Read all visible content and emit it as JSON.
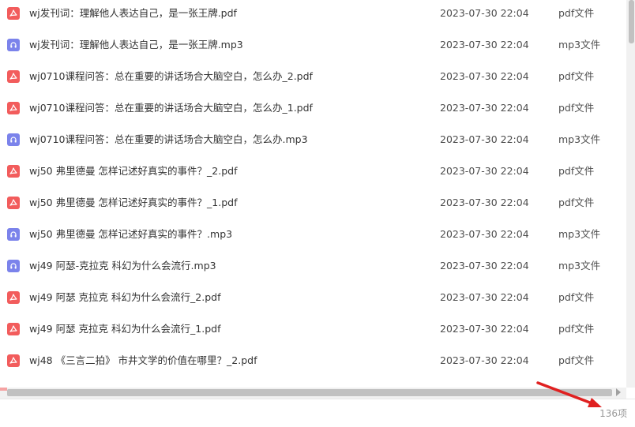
{
  "files": [
    {
      "name": "wj发刊词：理解他人表达自己，是一张王牌.pdf",
      "date": "2023-07-30 22:04",
      "type": "pdf文件",
      "icon": "pdf-icon"
    },
    {
      "name": "wj发刊词：理解他人表达自己，是一张王牌.mp3",
      "date": "2023-07-30 22:04",
      "type": "mp3文件",
      "icon": "audio-icon"
    },
    {
      "name": "wj0710课程问答：总在重要的讲话场合大脑空白，怎么办_2.pdf",
      "date": "2023-07-30 22:04",
      "type": "pdf文件",
      "icon": "pdf-icon"
    },
    {
      "name": "wj0710课程问答：总在重要的讲话场合大脑空白，怎么办_1.pdf",
      "date": "2023-07-30 22:04",
      "type": "pdf文件",
      "icon": "pdf-icon"
    },
    {
      "name": "wj0710课程问答：总在重要的讲话场合大脑空白，怎么办.mp3",
      "date": "2023-07-30 22:04",
      "type": "mp3文件",
      "icon": "audio-icon"
    },
    {
      "name": "wj50 弗里德曼 怎样记述好真实的事件？_2.pdf",
      "date": "2023-07-30 22:04",
      "type": "pdf文件",
      "icon": "pdf-icon"
    },
    {
      "name": "wj50 弗里德曼 怎样记述好真实的事件？_1.pdf",
      "date": "2023-07-30 22:04",
      "type": "pdf文件",
      "icon": "pdf-icon"
    },
    {
      "name": "wj50 弗里德曼 怎样记述好真实的事件？.mp3",
      "date": "2023-07-30 22:04",
      "type": "mp3文件",
      "icon": "audio-icon"
    },
    {
      "name": "wj49 阿瑟-克拉克 科幻为什么会流行.mp3",
      "date": "2023-07-30 22:04",
      "type": "mp3文件",
      "icon": "audio-icon"
    },
    {
      "name": "wj49 阿瑟 克拉克 科幻为什么会流行_2.pdf",
      "date": "2023-07-30 22:04",
      "type": "pdf文件",
      "icon": "pdf-icon"
    },
    {
      "name": "wj49 阿瑟 克拉克 科幻为什么会流行_1.pdf",
      "date": "2023-07-30 22:04",
      "type": "pdf文件",
      "icon": "pdf-icon"
    },
    {
      "name": "wj48 《三言二拍》 市井文学的价值在哪里？_2.pdf",
      "date": "2023-07-30 22:04",
      "type": "pdf文件",
      "icon": "pdf-icon"
    }
  ],
  "footer": {
    "count": "136项"
  },
  "colors": {
    "pdf": "#f25c5c",
    "audio": "#7b83eb",
    "annotation_arrow": "#e02020"
  }
}
